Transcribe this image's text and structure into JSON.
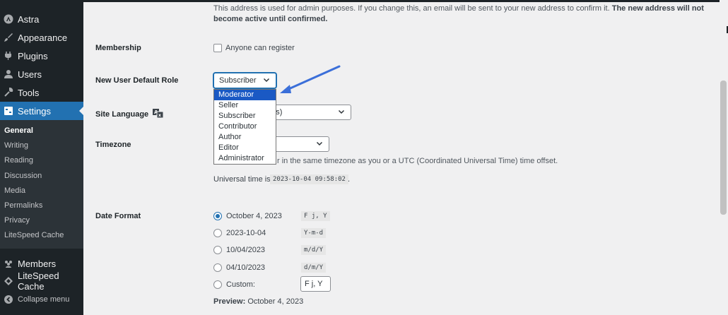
{
  "sidebar": {
    "menu": [
      {
        "label": "Astra",
        "icon": "astra-icon"
      },
      {
        "label": "Appearance",
        "icon": "paintbrush-icon"
      },
      {
        "label": "Plugins",
        "icon": "plug-icon"
      },
      {
        "label": "Users",
        "icon": "user-icon"
      },
      {
        "label": "Tools",
        "icon": "wrench-icon"
      },
      {
        "label": "Settings",
        "icon": "settings-icon"
      }
    ],
    "submenu": [
      "General",
      "Writing",
      "Reading",
      "Discussion",
      "Media",
      "Permalinks",
      "Privacy",
      "LiteSpeed Cache"
    ],
    "bottom_menu": [
      {
        "label": "Members",
        "icon": "members-icon"
      },
      {
        "label": "LiteSpeed Cache",
        "icon": "diamond-icon"
      },
      {
        "label": "Collapse menu",
        "icon": "collapse-icon"
      }
    ]
  },
  "email_note": {
    "line1": "This address is used for admin purposes. If you change this, an email will be sent to your new address to confirm it.",
    "line1_bold": "The new address will not",
    "line2_bold": "become active until confirmed."
  },
  "membership": {
    "label": "Membership",
    "checkbox_label": "Anyone can register"
  },
  "default_role": {
    "label": "New User Default Role",
    "selected": "Subscriber",
    "options": [
      "Moderator",
      "Seller",
      "Subscriber",
      "Contributor",
      "Author",
      "Editor",
      "Administrator"
    ],
    "highlighted": "Moderator"
  },
  "site_language": {
    "label": "Site Language",
    "value_partial": "ates)",
    "icon": "translate-icon"
  },
  "timezone": {
    "label": "Timezone",
    "desc_partial": "r in the same timezone as you or a UTC (Coordinated Universal Time) time offset.",
    "universal_label": "Universal time is",
    "universal_value": "2023-10-04 09:58:02",
    "universal_suffix": "."
  },
  "date_format": {
    "label": "Date Format",
    "options": [
      {
        "label": "October 4, 2023",
        "code": "F j, Y",
        "checked": true
      },
      {
        "label": "2023-10-04",
        "code": "Y-m-d",
        "checked": false
      },
      {
        "label": "10/04/2023",
        "code": "m/d/Y",
        "checked": false
      },
      {
        "label": "04/10/2023",
        "code": "d/m/Y",
        "checked": false
      }
    ],
    "custom_label": "Custom:",
    "custom_value": "F j, Y",
    "preview_label": "Preview:",
    "preview_value": "October 4, 2023"
  },
  "colors": {
    "accent": "#2271b1",
    "sidebar": "#1d2327",
    "highlight": "#1a59c4",
    "arrow": "#3b6fd9"
  }
}
